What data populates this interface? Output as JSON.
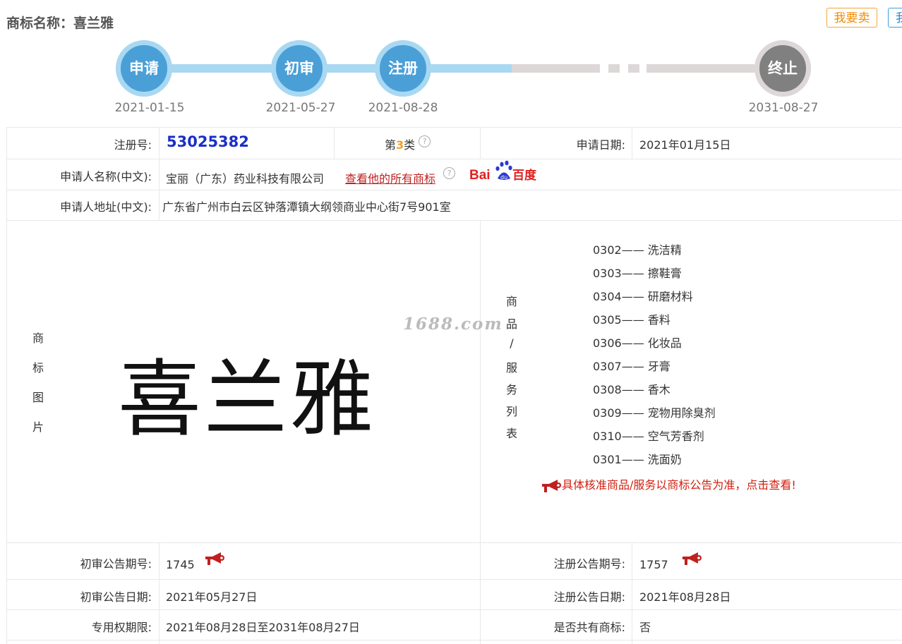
{
  "header": {
    "title": "商标名称：喜兰雅",
    "sell_label": "我要卖",
    "buy_label": "我"
  },
  "timeline": [
    {
      "label": "申请",
      "date": "2021-01-15"
    },
    {
      "label": "初审",
      "date": "2021-05-27"
    },
    {
      "label": "注册",
      "date": "2021-08-28"
    },
    {
      "label": "终止",
      "date": "2031-08-27"
    }
  ],
  "info": {
    "reg_no_label": "注册号:",
    "reg_no": "53025382",
    "class_prefix": "第",
    "class_num": "3",
    "class_suffix": "类",
    "help_icon": "?",
    "apply_date_label": "申请日期:",
    "apply_date": "2021年01月15日",
    "applicant_label": "申请人名称(中文):",
    "applicant": "宝丽（广东）药业科技有限公司",
    "all_marks_link": "查看他的所有商标",
    "baidu_label": "Bai百度",
    "address_label": "申请人地址(中文):",
    "address": "广东省广州市白云区钟落潭镇大纲领商业中心街7号901室",
    "image_label": [
      "商",
      "标",
      "图",
      "片"
    ],
    "trademark_word": "喜兰雅",
    "watermark": "1688.com",
    "goods_label": [
      "商",
      "品",
      "/",
      "服",
      "务",
      "列",
      "表"
    ],
    "goods": [
      "0302—— 洗洁精",
      "0303—— 擦鞋膏",
      "0304—— 研磨材料",
      "0305—— 香料",
      "0306—— 化妆品",
      "0307—— 牙膏",
      "0308—— 香木",
      "0309—— 宠物用除臭剂",
      "0310—— 空气芳香剂",
      "0301—— 洗面奶"
    ],
    "goods_notice": "具体核准商品/服务以商标公告为准，点击查看!",
    "prelim_no_label": "初审公告期号:",
    "prelim_no": "1745",
    "reg_notice_no_label": "注册公告期号:",
    "reg_notice_no": "1757",
    "prelim_date_label": "初审公告日期:",
    "prelim_date": "2021年05月27日",
    "reg_notice_date_label": "注册公告日期:",
    "reg_notice_date": "2021年08月28日",
    "exclusive_label": "专用权期限:",
    "exclusive": "2021年08月28日至2031年08月27日",
    "shared_label": "是否共有商标:",
    "shared": "否"
  },
  "colors": {
    "timeline_active": "#4a9fd7",
    "timeline_track": "#a8d8f2",
    "timeline_inactive": "#808080",
    "reg_no": "#1a2fc8",
    "link": "#c02020"
  }
}
